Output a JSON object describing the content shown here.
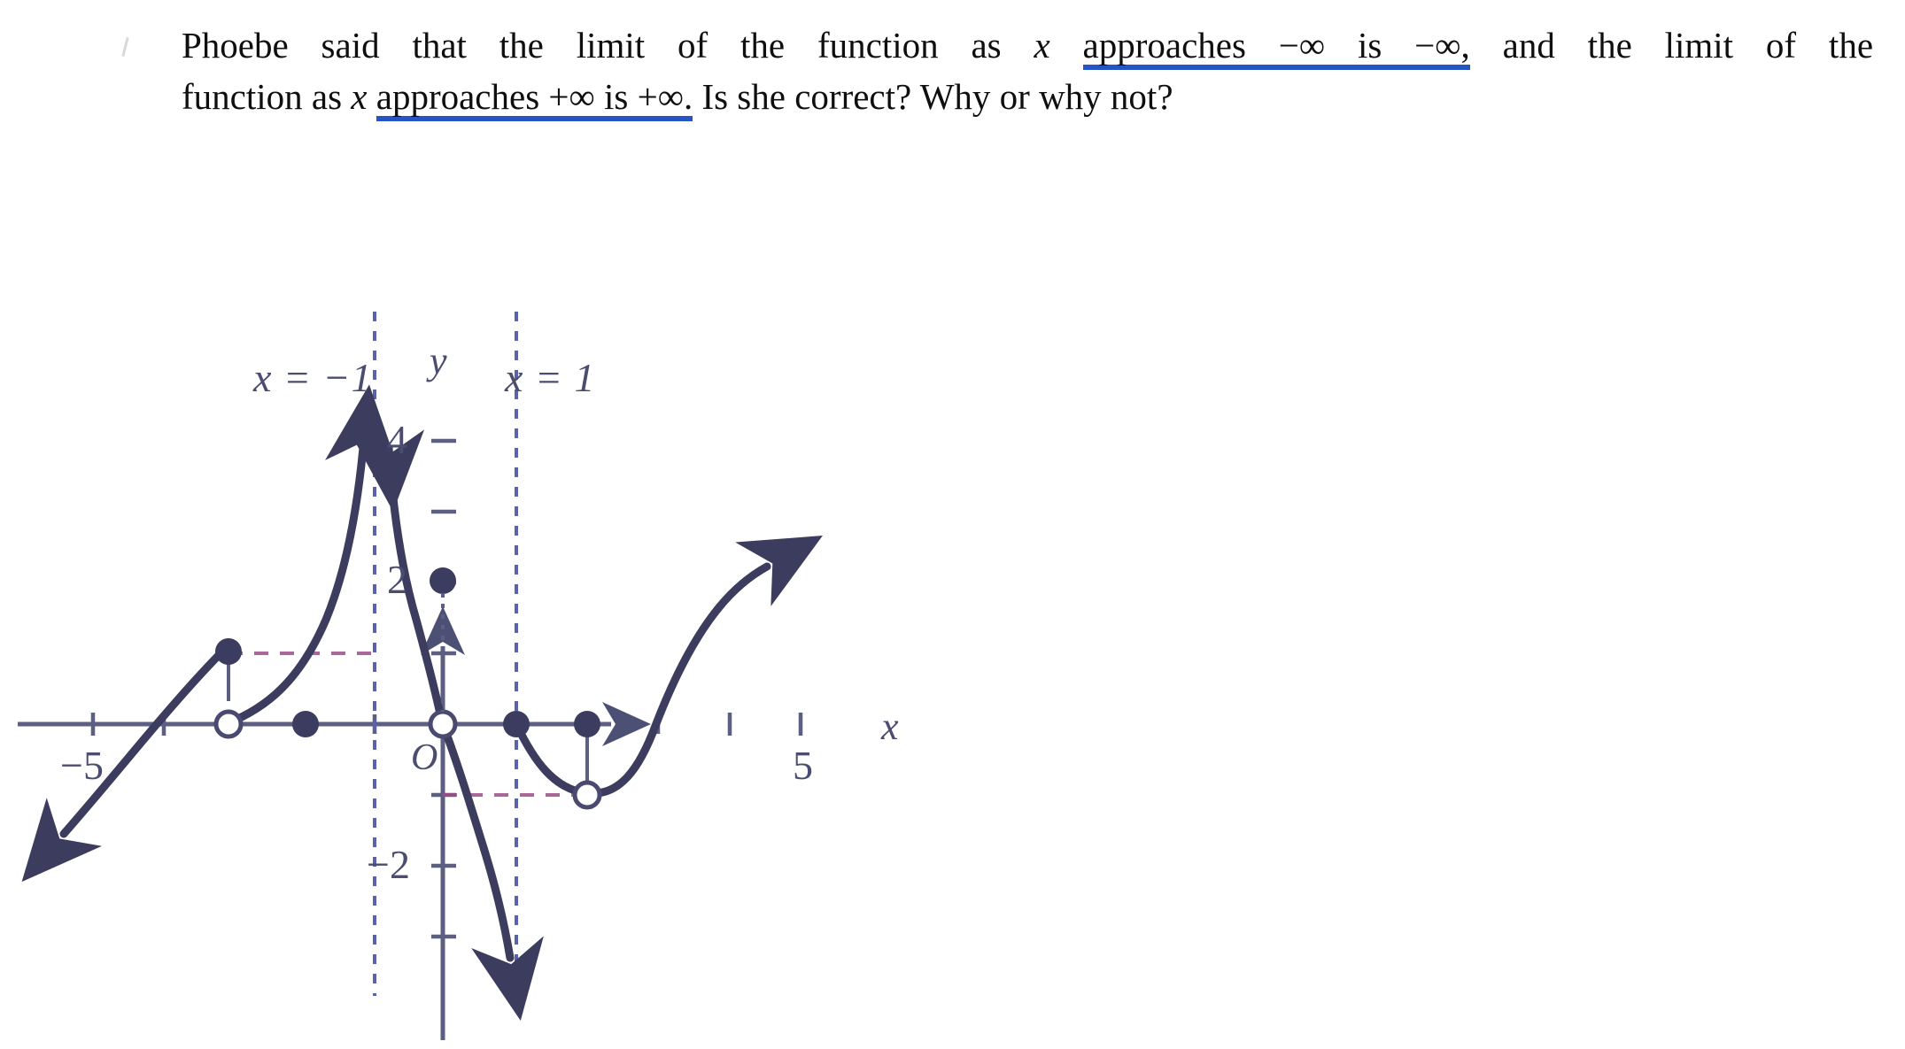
{
  "question": {
    "segment_1": "Phoebe said that the limit of the function as ",
    "var_x_1": "x",
    "underlined_1": "approaches −∞ is −∞,",
    "segment_2": " and the limit of the",
    "segment_3": "function as ",
    "var_x_2": "x",
    "underlined_2": "approaches +∞ is +∞.",
    "segment_4": " Is she correct? Why or why not?",
    "underline_color": "#2554c7",
    "text_color": "#100f10"
  },
  "chart_data": {
    "type": "line",
    "title": "",
    "xlabel": "x",
    "ylabel": "y",
    "xlim": [
      -6.2,
      6.2
    ],
    "ylim": [
      -4.2,
      4.8
    ],
    "grid": false,
    "legend": null,
    "axis_color": "#5c5f82",
    "curve_color": "#3c3c5e",
    "asymptote_color": "#5b63a8",
    "dash_guide_color": "#9a4d86",
    "x_tick_labels": [
      {
        "value": -5,
        "text": "−5"
      },
      {
        "value": 5,
        "text": "5"
      }
    ],
    "y_tick_labels": [
      {
        "value": 4,
        "text": "4"
      },
      {
        "value": 2,
        "text": "2"
      },
      {
        "value": -2,
        "text": "−2"
      }
    ],
    "origin_label": "O",
    "x_ticks": [
      -5,
      -4,
      -3,
      -2,
      -1,
      1,
      2,
      3,
      4,
      5
    ],
    "y_ticks": [
      -3,
      -2,
      -1,
      1,
      2,
      3,
      4
    ],
    "vertical_asymptotes": [
      {
        "x": -1,
        "label": "x = −1"
      },
      {
        "x": 1,
        "label": "x = 1"
      }
    ],
    "filled_points": [
      {
        "x": 0,
        "y": 2
      },
      {
        "x": -2,
        "y": 1
      },
      {
        "x": -1.5,
        "y": 0
      },
      {
        "x": 1,
        "y": 0
      },
      {
        "x": 2,
        "y": 0
      }
    ],
    "open_points": [
      {
        "x": -2,
        "y": 0
      },
      {
        "x": 0,
        "y": 0
      },
      {
        "x": 2,
        "y": -1
      }
    ],
    "guide_segments": [
      {
        "from": [
          -2,
          1
        ],
        "to": [
          -1,
          1
        ]
      },
      {
        "from": [
          0,
          -1
        ],
        "to": [
          2,
          -1
        ]
      }
    ],
    "branches": [
      {
        "name": "far-left-branch",
        "desc": "rises from lower-left with arrow, passes through x ≈ -3, ends at open circle (-2,0) and filled dot (-2,1)"
      },
      {
        "name": "left-asymptotic-branch",
        "desc": "from (-2,0) rises steeply to +∞ along x = -1"
      },
      {
        "name": "middle-branch",
        "desc": "from +∞ along x = -1 descends through (0,0) to -∞ along x = 1"
      },
      {
        "name": "right-parabola-branch",
        "desc": "from (1,0) dips to vertex near (2,-1) then rises through (3,0) with arrow up-right"
      }
    ],
    "arrows": [
      {
        "name": "x-axis-arrow",
        "direction": "right"
      },
      {
        "name": "y-axis-arrow",
        "direction": "up"
      },
      {
        "name": "lower-left-curve-arrow",
        "direction": "down-left"
      },
      {
        "name": "left-asymptote-arrow",
        "direction": "up"
      },
      {
        "name": "middle-asymptote-up-arrow",
        "direction": "up"
      },
      {
        "name": "middle-asymptote-down-arrow",
        "direction": "down"
      },
      {
        "name": "right-curve-arrow",
        "direction": "up-right"
      }
    ]
  }
}
